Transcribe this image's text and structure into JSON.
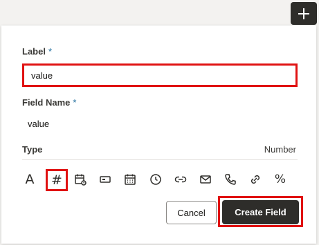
{
  "toolbar": {
    "add_icon": "plus-icon"
  },
  "form": {
    "label": {
      "title": "Label",
      "required_marker": "*",
      "value": "value"
    },
    "field_name": {
      "title": "Field Name",
      "required_marker": "*",
      "value": "value"
    },
    "type": {
      "title": "Type",
      "selected_label": "Number",
      "options": [
        {
          "icon": "text-icon",
          "glyph": "A"
        },
        {
          "icon": "number-icon",
          "glyph": "#"
        },
        {
          "icon": "date-time-icon"
        },
        {
          "icon": "input-box-icon"
        },
        {
          "icon": "calendar-icon"
        },
        {
          "icon": "clock-icon"
        },
        {
          "icon": "link-icon"
        },
        {
          "icon": "email-icon"
        },
        {
          "icon": "phone-icon"
        },
        {
          "icon": "url-link-icon"
        },
        {
          "icon": "percent-icon",
          "glyph": "%"
        }
      ]
    },
    "actions": {
      "cancel_label": "Cancel",
      "create_label": "Create Field"
    }
  },
  "colors": {
    "accent": "#2e2d2a",
    "highlight": "#e01212",
    "required": "#1d6c9c"
  }
}
